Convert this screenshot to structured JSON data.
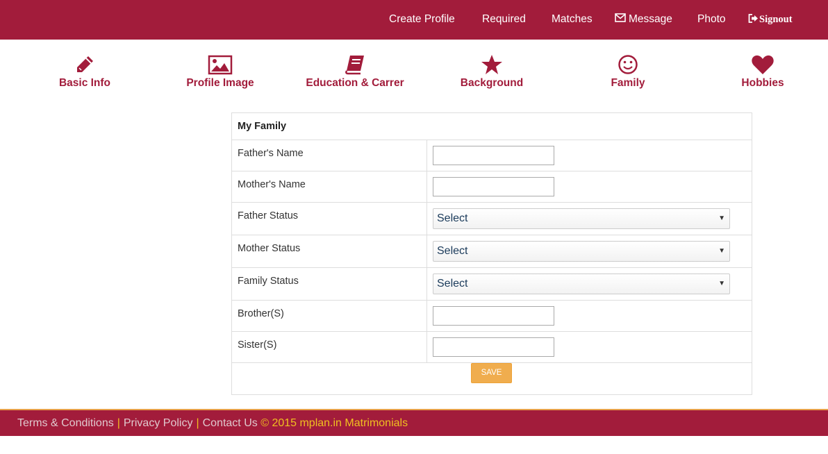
{
  "colors": {
    "brand": "#a21c3b",
    "accent": "#f0ad4e",
    "footer_border": "#e8a14a",
    "copyright": "#f0c020"
  },
  "navbar": {
    "items": [
      {
        "label": "Create Profile"
      },
      {
        "label": "Required"
      },
      {
        "label": "Matches"
      },
      {
        "label": "Message",
        "icon": "envelope-icon"
      },
      {
        "label": "Photo"
      },
      {
        "label": "Signout",
        "icon": "signout-icon"
      }
    ]
  },
  "tabs": [
    {
      "label": "Basic Info",
      "icon": "pencil-icon"
    },
    {
      "label": "Profile Image",
      "icon": "image-icon"
    },
    {
      "label": "Education & Carrer",
      "icon": "book-icon"
    },
    {
      "label": "Background",
      "icon": "star-icon"
    },
    {
      "label": "Family",
      "icon": "smiley-icon"
    },
    {
      "label": "Hobbies",
      "icon": "heart-icon"
    }
  ],
  "form": {
    "title": "My Family",
    "fields": [
      {
        "label": "Father's Name",
        "type": "text",
        "value": ""
      },
      {
        "label": "Mother's Name",
        "type": "text",
        "value": ""
      },
      {
        "label": "Father Status",
        "type": "select",
        "value": "Select"
      },
      {
        "label": "Mother Status",
        "type": "select",
        "value": "Select"
      },
      {
        "label": "Family Status",
        "type": "select",
        "value": "Select"
      },
      {
        "label": "Brother(S)",
        "type": "text",
        "value": ""
      },
      {
        "label": "Sister(S)",
        "type": "text",
        "value": ""
      }
    ],
    "save_label": "SAVE"
  },
  "footer": {
    "terms": "Terms & Conditions",
    "separator": "|",
    "privacy": "Privacy Policy",
    "contact": "Contact Us",
    "copyright": "© 2015 mplan.in Matrimonials"
  }
}
